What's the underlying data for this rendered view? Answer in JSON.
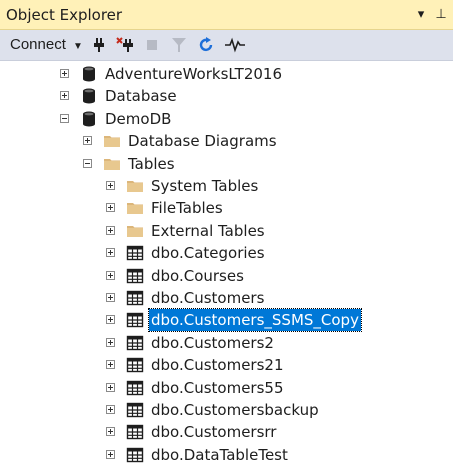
{
  "title": "Object Explorer",
  "title_buttons": {
    "dropdown": "▾",
    "pin": "⊥"
  },
  "toolbar": {
    "connect_label": "Connect"
  },
  "tree": {
    "items": [
      {
        "label": "AdventureWorksLT2016",
        "icon": "database-icon",
        "expander": "plus"
      },
      {
        "label": "Database",
        "icon": "database-icon",
        "expander": "plus"
      },
      {
        "label": "DemoDB",
        "icon": "database-icon",
        "expander": "minus"
      },
      {
        "label": "Database Diagrams",
        "icon": "folder-icon",
        "expander": "plus"
      },
      {
        "label": "Tables",
        "icon": "folder-icon",
        "expander": "minus"
      },
      {
        "label": "System Tables",
        "icon": "folder-icon",
        "expander": "plus"
      },
      {
        "label": "FileTables",
        "icon": "folder-icon",
        "expander": "plus"
      },
      {
        "label": "External Tables",
        "icon": "folder-icon",
        "expander": "plus"
      },
      {
        "label": "dbo.Categories",
        "icon": "table-icon",
        "expander": "plus"
      },
      {
        "label": "dbo.Courses",
        "icon": "table-icon",
        "expander": "plus"
      },
      {
        "label": "dbo.Customers",
        "icon": "table-icon",
        "expander": "plus"
      },
      {
        "label": "dbo.Customers_SSMS_Copy",
        "icon": "table-icon",
        "expander": "plus",
        "selected": true
      },
      {
        "label": "dbo.Customers2",
        "icon": "table-icon",
        "expander": "plus"
      },
      {
        "label": "dbo.Customers21",
        "icon": "table-icon",
        "expander": "plus"
      },
      {
        "label": "dbo.Customers55",
        "icon": "table-icon",
        "expander": "plus"
      },
      {
        "label": "dbo.Customersbackup",
        "icon": "table-icon",
        "expander": "plus"
      },
      {
        "label": "dbo.Customersrr",
        "icon": "table-icon",
        "expander": "plus"
      },
      {
        "label": "dbo.DataTableTest",
        "icon": "table-icon",
        "expander": "plus"
      }
    ]
  }
}
